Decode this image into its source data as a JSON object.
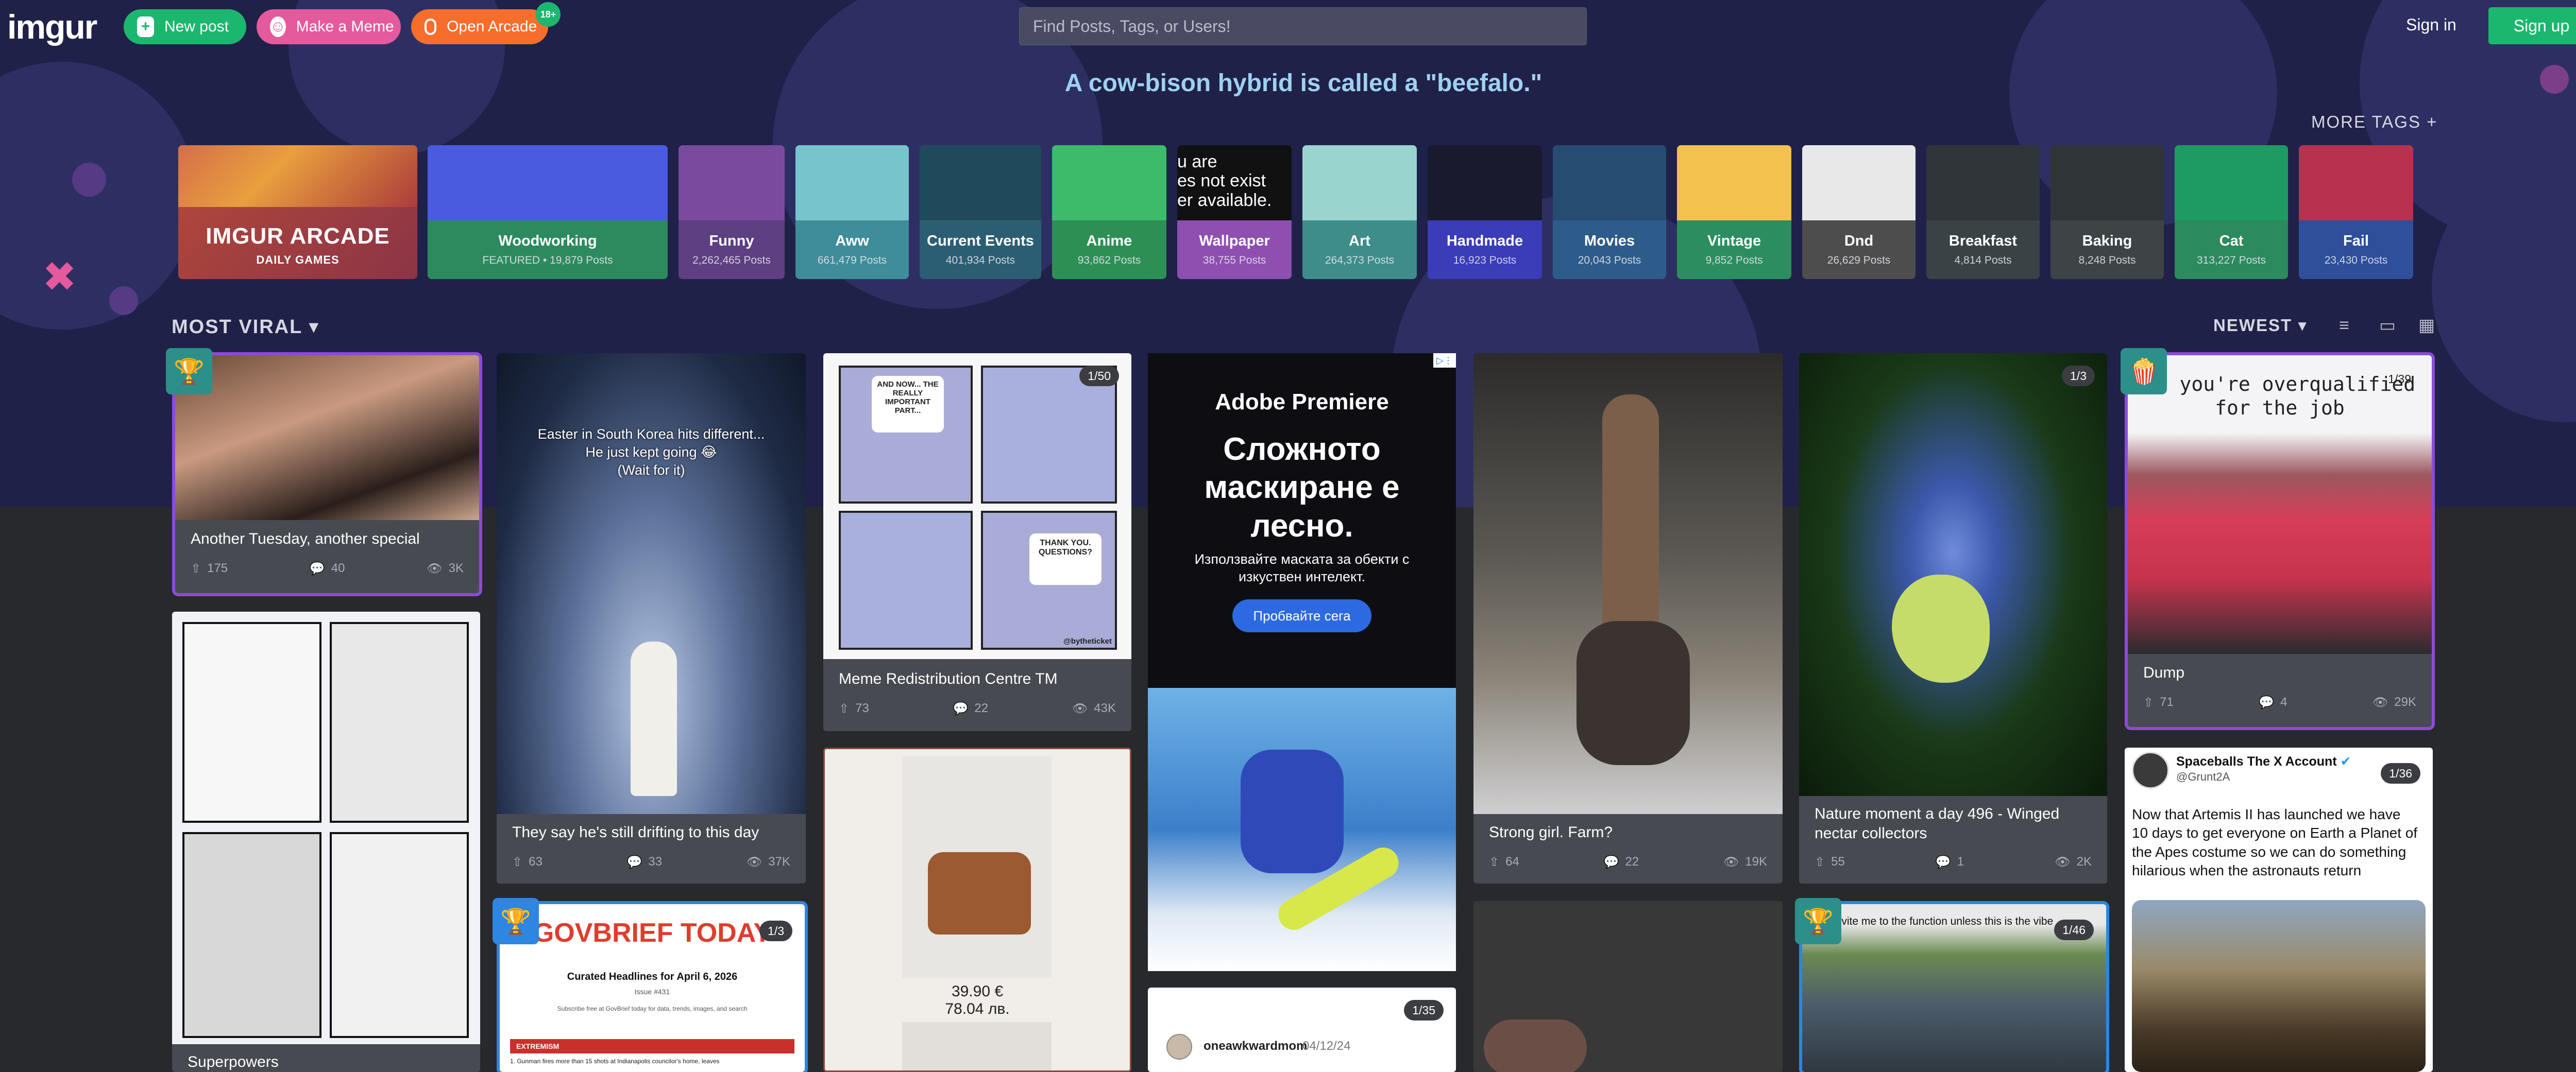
{
  "header": {
    "logo": "imgur",
    "new_post_label": "New post",
    "make_meme_label": "Make a Meme",
    "open_arcade_label": "Open Arcade",
    "arcade_badge": "18+",
    "search_placeholder": "Find Posts, Tags, or Users!",
    "sign_in": "Sign in",
    "sign_up": "Sign up"
  },
  "fact": "A cow-bison hybrid is called a \"beefalo.\"",
  "more_tags": "MORE TAGS +",
  "arcade_tile": {
    "title": "IMGUR ARCADE",
    "subtitle": "DAILY GAMES"
  },
  "tags": [
    {
      "name": "Woodworking",
      "count": "FEATURED • 19,879 Posts",
      "color": "#2d8a5f",
      "art": "#4a5be0"
    },
    {
      "name": "Funny",
      "count": "2,262,465 Posts",
      "color": "#5d3f82",
      "art": "#7a4a9e"
    },
    {
      "name": "Aww",
      "count": "661,479 Posts",
      "color": "#3f8c9a",
      "art": "#78c4cc"
    },
    {
      "name": "Current Events",
      "count": "401,934 Posts",
      "color": "#2b5e73",
      "art": "#1f4a5c"
    },
    {
      "name": "Anime",
      "count": "93,862 Posts",
      "color": "#2e8f55",
      "art": "#3dbb6b"
    },
    {
      "name": "Wallpaper",
      "count": "38,755 Posts",
      "color": "#8e4fb0",
      "art": "#111111"
    },
    {
      "name": "Art",
      "count": "264,373 Posts",
      "color": "#3e8d8a",
      "art": "#9ad4cf"
    },
    {
      "name": "Handmade",
      "count": "16,923 Posts",
      "color": "#3a3cb8",
      "art": "#1a1a2e"
    },
    {
      "name": "Movies",
      "count": "20,043 Posts",
      "color": "#2e5c8a",
      "art": "#264c72"
    },
    {
      "name": "Vintage",
      "count": "9,852 Posts",
      "color": "#2c8e60",
      "art": "#f2c14e"
    },
    {
      "name": "Dnd",
      "count": "26,629 Posts",
      "color": "#4d4d4d",
      "art": "#e8e8e8"
    },
    {
      "name": "Breakfast",
      "count": "4,814 Posts",
      "color": "#3a4246",
      "art": "#2f3538"
    },
    {
      "name": "Baking",
      "count": "8,248 Posts",
      "color": "#3e4345",
      "art": "#2f3436"
    },
    {
      "name": "Cat",
      "count": "313,227 Posts",
      "color": "#2b8a5e",
      "art": "#1e9b62"
    },
    {
      "name": "Fail",
      "count": "23,430 Posts",
      "color": "#2e4f9a",
      "art": "#b8324f"
    }
  ],
  "wallpaper_art_text": "u are\nes not exist\ner available.",
  "filters": {
    "most_viral": "MOST VIRAL",
    "newest": "NEWEST"
  },
  "posts": {
    "p1": {
      "title": "Another Tuesday, another special",
      "ups": "175",
      "comments": "40",
      "views": "3K"
    },
    "p2": {
      "title": "They say he's still drifting to this day",
      "ups": "63",
      "comments": "33",
      "views": "37K",
      "overlay": "Easter in South Korea hits different...\nHe just kept going 😂\n(Wait for it)"
    },
    "p3": {
      "title": "Meme Redistribution Centre TM",
      "ups": "73",
      "comments": "22",
      "views": "43K",
      "badge": "1/50"
    },
    "p4": {
      "title": "Strong girl. Farm?",
      "ups": "64",
      "comments": "22",
      "views": "19K"
    },
    "p5": {
      "title": "Nature moment a day 496 - Winged nectar collectors",
      "ups": "55",
      "comments": "1",
      "views": "2K",
      "badge": "1/3"
    },
    "p6": {
      "title": "Dump",
      "ups": "71",
      "comments": "4",
      "views": "29K",
      "badge": "1/39",
      "overlay": "en you're overqualified\nfor the job"
    },
    "p7": {
      "title": "Superpowers"
    },
    "p8": {
      "badge": "1/3",
      "brand": "GOVBRIEF TODAY",
      "headline": "Curated Headlines for April 6, 2026",
      "issue": "Issue #431",
      "note": "Subscribe free at GovBrief today for data, trends, images, and search",
      "section": "EXTREMISM",
      "item": "1. Gunman fires more than 15 shots at Indianapolis councilor's home, leaves"
    },
    "p9": {
      "price": "39.90 €",
      "price2": "78.04 лв."
    },
    "p10": {
      "badge": "1/35",
      "user": "oneawkwardmom",
      "date": "04/12/24"
    },
    "p11": {
      "badge": "1/46",
      "overlay": "invite me to the function unless this is the vibe"
    },
    "p12": {
      "badge": "1/36",
      "account": "Spaceballs The X Account",
      "handle": "@Grunt2A",
      "text": "Now that Artemis II has launched we have 10 days to get everyone on Earth a Planet of the Apes costume so we can do something hilarious when the astronauts return"
    }
  },
  "comic1": {
    "panel1": "AND NOW... THE REALLY IMPORTANT PART...",
    "panel4": "THANK YOU. QUESTIONS?",
    "credit": "@bytheticket"
  },
  "ad": {
    "brand": "Adobe Premiere",
    "headline": "Сложното маскиране е лесно.",
    "body": "Използвайте маската за обекти с изкуствен интелект.",
    "cta": "Пробвайте сега"
  }
}
